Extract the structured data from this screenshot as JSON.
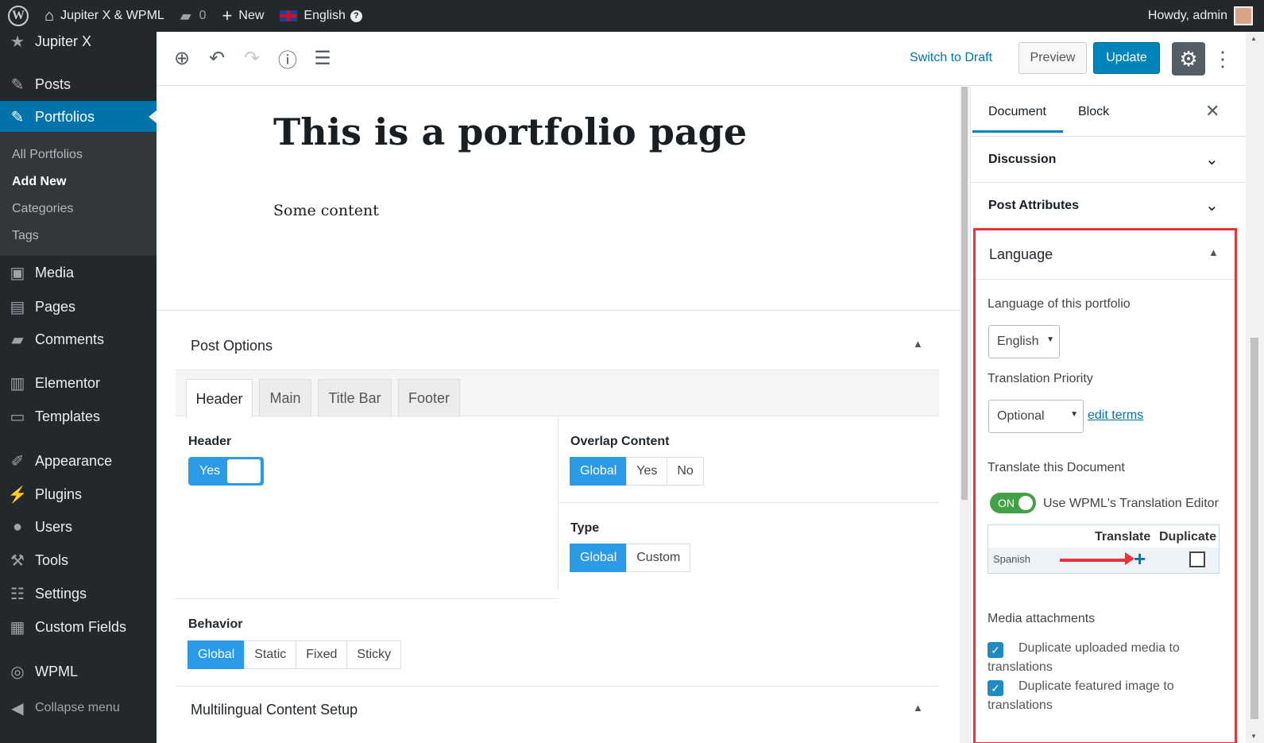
{
  "adminbar": {
    "site_name": "Jupiter X & WPML",
    "comments_count": "0",
    "new_label": "New",
    "language": "English",
    "howdy": "Howdy, admin"
  },
  "sidebar": {
    "items": [
      {
        "label": "Jupiter X",
        "icon": "star-icon"
      },
      {
        "label": "Posts",
        "icon": "pin-icon"
      },
      {
        "label": "Portfolios",
        "icon": "pin-icon"
      },
      {
        "label": "Media",
        "icon": "media-icon"
      },
      {
        "label": "Pages",
        "icon": "pages-icon"
      },
      {
        "label": "Comments",
        "icon": "comment-icon"
      },
      {
        "label": "Elementor",
        "icon": "elementor-icon"
      },
      {
        "label": "Templates",
        "icon": "folder-icon"
      },
      {
        "label": "Appearance",
        "icon": "brush-icon"
      },
      {
        "label": "Plugins",
        "icon": "plug-icon"
      },
      {
        "label": "Users",
        "icon": "user-icon"
      },
      {
        "label": "Tools",
        "icon": "wrench-icon"
      },
      {
        "label": "Settings",
        "icon": "sliders-icon"
      },
      {
        "label": "Custom Fields",
        "icon": "table-icon"
      },
      {
        "label": "WPML",
        "icon": "wpml-icon"
      }
    ],
    "submenu": [
      "All Portfolios",
      "Add New",
      "Categories",
      "Tags"
    ],
    "collapse": "Collapse menu"
  },
  "toolbar": {
    "switch_draft": "Switch to Draft",
    "preview": "Preview",
    "update": "Update"
  },
  "post": {
    "title": "This is a portfolio page",
    "body": "Some content"
  },
  "post_options": {
    "title": "Post Options",
    "tabs": [
      "Header",
      "Main",
      "Title Bar",
      "Footer"
    ],
    "header_label": "Header",
    "header_toggle": "Yes",
    "overlap_label": "Overlap Content",
    "overlap_options": [
      "Global",
      "Yes",
      "No"
    ],
    "type_label": "Type",
    "type_options": [
      "Global",
      "Custom"
    ],
    "behavior_label": "Behavior",
    "behavior_options": [
      "Global",
      "Static",
      "Fixed",
      "Sticky"
    ],
    "multilingual_title": "Multilingual Content Setup"
  },
  "settings": {
    "tab_document": "Document",
    "tab_block": "Block",
    "discussion": "Discussion",
    "post_attributes": "Post Attributes",
    "language": {
      "title": "Language",
      "lang_label": "Language of this portfolio",
      "lang_value": "English",
      "priority_label": "Translation Priority",
      "priority_value": "Optional",
      "edit_terms": "edit terms",
      "translate_label": "Translate this Document",
      "toggle_on": "ON",
      "editor_label": "Use WPML's Translation Editor",
      "col_translate": "Translate",
      "col_duplicate": "Duplicate",
      "row_lang": "Spanish",
      "media_label": "Media attachments",
      "dup_media": "Duplicate uploaded media to translations",
      "dup_featured": "Duplicate featured image to translations"
    }
  },
  "colors": {
    "admin_dark": "#23282d",
    "wp_blue": "#0073aa",
    "option_blue": "#2b9be8",
    "highlight_red": "#e8353d",
    "toggle_green": "#43a047"
  }
}
